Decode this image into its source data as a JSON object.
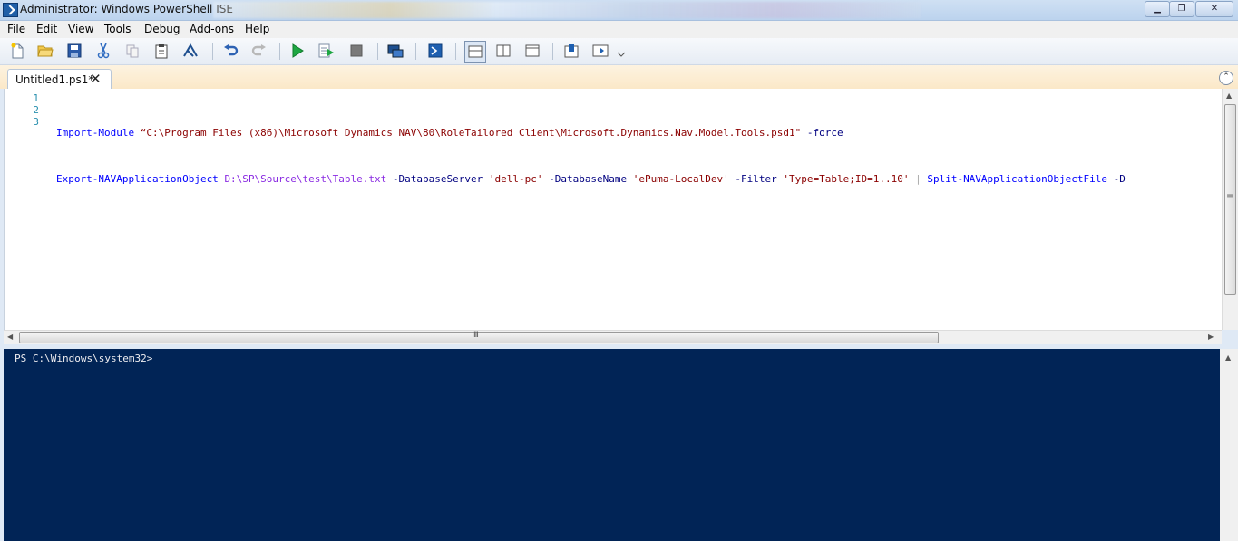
{
  "window": {
    "title": "Administrator: Windows PowerShell ISE",
    "controls": {
      "minimize": "▁",
      "restore": "❐",
      "close": "✕"
    }
  },
  "menu": [
    "File",
    "Edit",
    "View",
    "Tools",
    "Debug",
    "Add-ons",
    "Help"
  ],
  "toolbar": {
    "buttons": [
      "new-icon",
      "open-icon",
      "save-icon",
      "cut-icon",
      "copy-icon",
      "paste-icon",
      "clear-console-icon",
      "undo-icon",
      "redo-icon",
      "run-icon",
      "run-selection-icon",
      "stop-icon",
      "remote-powershell-icon",
      "powershell-console-icon",
      "script-pane-top-icon",
      "script-pane-right-icon",
      "script-pane-maximized-icon",
      "show-command-window-icon",
      "show-command-addon-icon"
    ]
  },
  "tabs": [
    {
      "label": "Untitled1.ps1*",
      "close": "✕"
    }
  ],
  "editor": {
    "line_numbers": [
      "1",
      "2",
      "3"
    ],
    "line1": {
      "cmd": "Import-Module",
      "path": "“C:\\Program Files (x86)\\Microsoft Dynamics NAV\\80\\RoleTailored Client\\Microsoft.Dynamics.Nav.Model.Tools.psd1\"",
      "param": "-force"
    },
    "line2": {
      "cmd": "Export-NAVApplicationObject",
      "arg": "D:\\SP\\Source\\test\\Table.txt",
      "p1": "-DatabaseServer",
      "v1": "'dell-pc'",
      "p2": "-DatabaseName",
      "v2": "'ePuma-LocalDev'",
      "p3": "-Filter",
      "v3": "'Type=Table;ID=1..10'",
      "pipe": "|",
      "cmd2": "Split-NAVApplicationObjectFile",
      "p4": "-D"
    },
    "scroll_glyph": "≡",
    "hscroll_glyph": "III"
  },
  "console": {
    "prompt": "PS C:\\Windows\\system32>"
  },
  "colors": {
    "console_bg": "#012456",
    "tab_strip": "#fbe8c8",
    "cmd": "#0000ff",
    "string": "#8b0000",
    "param": "#000080",
    "argument": "#8a2be2"
  }
}
